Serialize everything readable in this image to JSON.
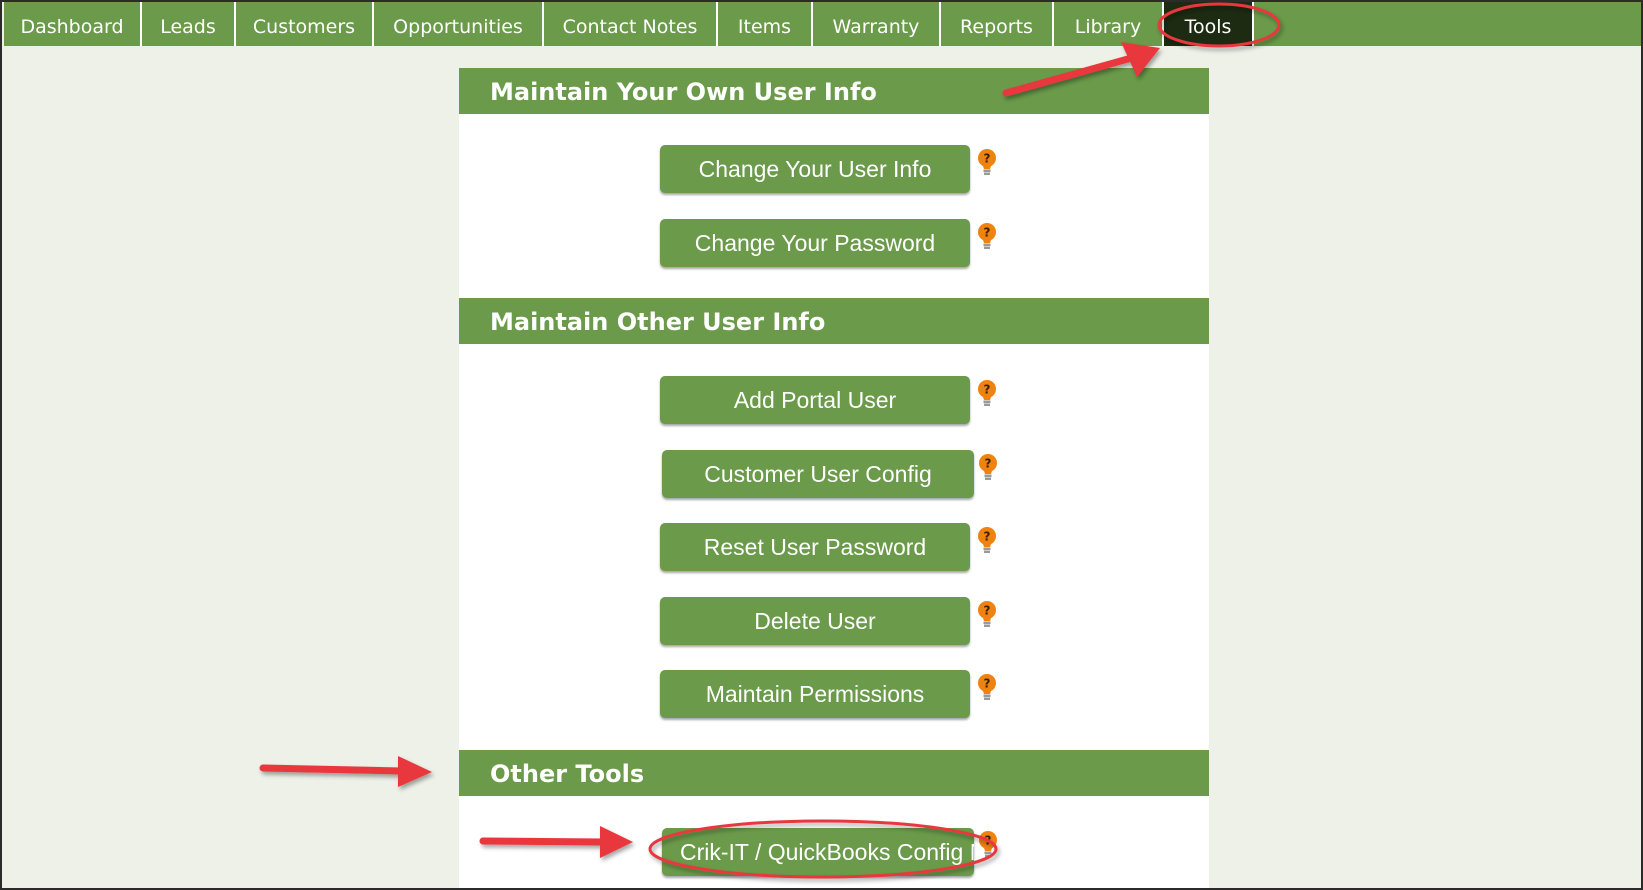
{
  "nav": {
    "tabs": [
      {
        "label": "Dashboard"
      },
      {
        "label": "Leads"
      },
      {
        "label": "Customers"
      },
      {
        "label": "Opportunities"
      },
      {
        "label": "Contact Notes"
      },
      {
        "label": "Items"
      },
      {
        "label": "Warranty"
      },
      {
        "label": "Reports"
      },
      {
        "label": "Library"
      },
      {
        "label": "Tools",
        "active": true
      }
    ]
  },
  "sections": [
    {
      "title": "Maintain Your Own User Info",
      "buttons": [
        {
          "label": "Change Your User Info",
          "help_icon": "help-bulb-icon"
        },
        {
          "label": "Change Your Password",
          "help_icon": "help-bulb-icon"
        }
      ]
    },
    {
      "title": "Maintain Other User Info",
      "buttons": [
        {
          "label": "Add Portal User",
          "help_icon": "help-bulb-icon"
        },
        {
          "label": "Customer User Config",
          "help_icon": "help-bulb-icon"
        },
        {
          "label": "Reset User Password",
          "help_icon": "help-bulb-icon"
        },
        {
          "label": "Delete User",
          "help_icon": "help-bulb-icon"
        },
        {
          "label": "Maintain Permissions",
          "help_icon": "help-bulb-icon"
        }
      ]
    },
    {
      "title": "Other Tools",
      "buttons": [
        {
          "label": "Crik-IT / QuickBooks Config M",
          "help_icon": "help-bulb-icon"
        }
      ]
    }
  ],
  "colors": {
    "nav_green": "#6a9a4a",
    "active_tab": "#1c2b12",
    "page_bg": "#edf1e8",
    "annotation_red": "#e8383d",
    "help_orange": "#f0820f"
  }
}
